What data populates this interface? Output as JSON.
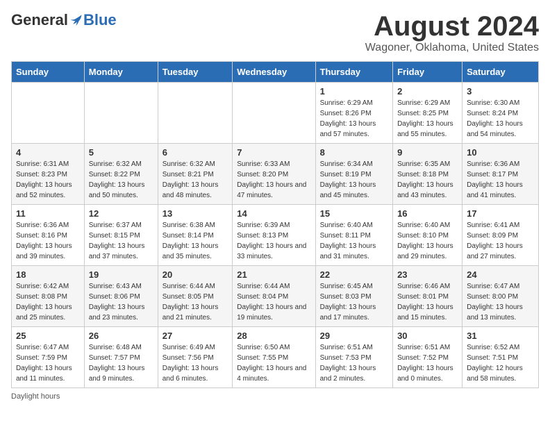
{
  "header": {
    "logo_general": "General",
    "logo_blue": "Blue",
    "month_year": "August 2024",
    "location": "Wagoner, Oklahoma, United States"
  },
  "days_of_week": [
    "Sunday",
    "Monday",
    "Tuesday",
    "Wednesday",
    "Thursday",
    "Friday",
    "Saturday"
  ],
  "footer": {
    "note": "Daylight hours"
  },
  "weeks": [
    [
      {
        "day": "",
        "sunrise": "",
        "sunset": "",
        "daylight": ""
      },
      {
        "day": "",
        "sunrise": "",
        "sunset": "",
        "daylight": ""
      },
      {
        "day": "",
        "sunrise": "",
        "sunset": "",
        "daylight": ""
      },
      {
        "day": "",
        "sunrise": "",
        "sunset": "",
        "daylight": ""
      },
      {
        "day": "1",
        "sunrise": "Sunrise: 6:29 AM",
        "sunset": "Sunset: 8:26 PM",
        "daylight": "Daylight: 13 hours and 57 minutes."
      },
      {
        "day": "2",
        "sunrise": "Sunrise: 6:29 AM",
        "sunset": "Sunset: 8:25 PM",
        "daylight": "Daylight: 13 hours and 55 minutes."
      },
      {
        "day": "3",
        "sunrise": "Sunrise: 6:30 AM",
        "sunset": "Sunset: 8:24 PM",
        "daylight": "Daylight: 13 hours and 54 minutes."
      }
    ],
    [
      {
        "day": "4",
        "sunrise": "Sunrise: 6:31 AM",
        "sunset": "Sunset: 8:23 PM",
        "daylight": "Daylight: 13 hours and 52 minutes."
      },
      {
        "day": "5",
        "sunrise": "Sunrise: 6:32 AM",
        "sunset": "Sunset: 8:22 PM",
        "daylight": "Daylight: 13 hours and 50 minutes."
      },
      {
        "day": "6",
        "sunrise": "Sunrise: 6:32 AM",
        "sunset": "Sunset: 8:21 PM",
        "daylight": "Daylight: 13 hours and 48 minutes."
      },
      {
        "day": "7",
        "sunrise": "Sunrise: 6:33 AM",
        "sunset": "Sunset: 8:20 PM",
        "daylight": "Daylight: 13 hours and 47 minutes."
      },
      {
        "day": "8",
        "sunrise": "Sunrise: 6:34 AM",
        "sunset": "Sunset: 8:19 PM",
        "daylight": "Daylight: 13 hours and 45 minutes."
      },
      {
        "day": "9",
        "sunrise": "Sunrise: 6:35 AM",
        "sunset": "Sunset: 8:18 PM",
        "daylight": "Daylight: 13 hours and 43 minutes."
      },
      {
        "day": "10",
        "sunrise": "Sunrise: 6:36 AM",
        "sunset": "Sunset: 8:17 PM",
        "daylight": "Daylight: 13 hours and 41 minutes."
      }
    ],
    [
      {
        "day": "11",
        "sunrise": "Sunrise: 6:36 AM",
        "sunset": "Sunset: 8:16 PM",
        "daylight": "Daylight: 13 hours and 39 minutes."
      },
      {
        "day": "12",
        "sunrise": "Sunrise: 6:37 AM",
        "sunset": "Sunset: 8:15 PM",
        "daylight": "Daylight: 13 hours and 37 minutes."
      },
      {
        "day": "13",
        "sunrise": "Sunrise: 6:38 AM",
        "sunset": "Sunset: 8:14 PM",
        "daylight": "Daylight: 13 hours and 35 minutes."
      },
      {
        "day": "14",
        "sunrise": "Sunrise: 6:39 AM",
        "sunset": "Sunset: 8:13 PM",
        "daylight": "Daylight: 13 hours and 33 minutes."
      },
      {
        "day": "15",
        "sunrise": "Sunrise: 6:40 AM",
        "sunset": "Sunset: 8:11 PM",
        "daylight": "Daylight: 13 hours and 31 minutes."
      },
      {
        "day": "16",
        "sunrise": "Sunrise: 6:40 AM",
        "sunset": "Sunset: 8:10 PM",
        "daylight": "Daylight: 13 hours and 29 minutes."
      },
      {
        "day": "17",
        "sunrise": "Sunrise: 6:41 AM",
        "sunset": "Sunset: 8:09 PM",
        "daylight": "Daylight: 13 hours and 27 minutes."
      }
    ],
    [
      {
        "day": "18",
        "sunrise": "Sunrise: 6:42 AM",
        "sunset": "Sunset: 8:08 PM",
        "daylight": "Daylight: 13 hours and 25 minutes."
      },
      {
        "day": "19",
        "sunrise": "Sunrise: 6:43 AM",
        "sunset": "Sunset: 8:06 PM",
        "daylight": "Daylight: 13 hours and 23 minutes."
      },
      {
        "day": "20",
        "sunrise": "Sunrise: 6:44 AM",
        "sunset": "Sunset: 8:05 PM",
        "daylight": "Daylight: 13 hours and 21 minutes."
      },
      {
        "day": "21",
        "sunrise": "Sunrise: 6:44 AM",
        "sunset": "Sunset: 8:04 PM",
        "daylight": "Daylight: 13 hours and 19 minutes."
      },
      {
        "day": "22",
        "sunrise": "Sunrise: 6:45 AM",
        "sunset": "Sunset: 8:03 PM",
        "daylight": "Daylight: 13 hours and 17 minutes."
      },
      {
        "day": "23",
        "sunrise": "Sunrise: 6:46 AM",
        "sunset": "Sunset: 8:01 PM",
        "daylight": "Daylight: 13 hours and 15 minutes."
      },
      {
        "day": "24",
        "sunrise": "Sunrise: 6:47 AM",
        "sunset": "Sunset: 8:00 PM",
        "daylight": "Daylight: 13 hours and 13 minutes."
      }
    ],
    [
      {
        "day": "25",
        "sunrise": "Sunrise: 6:47 AM",
        "sunset": "Sunset: 7:59 PM",
        "daylight": "Daylight: 13 hours and 11 minutes."
      },
      {
        "day": "26",
        "sunrise": "Sunrise: 6:48 AM",
        "sunset": "Sunset: 7:57 PM",
        "daylight": "Daylight: 13 hours and 9 minutes."
      },
      {
        "day": "27",
        "sunrise": "Sunrise: 6:49 AM",
        "sunset": "Sunset: 7:56 PM",
        "daylight": "Daylight: 13 hours and 6 minutes."
      },
      {
        "day": "28",
        "sunrise": "Sunrise: 6:50 AM",
        "sunset": "Sunset: 7:55 PM",
        "daylight": "Daylight: 13 hours and 4 minutes."
      },
      {
        "day": "29",
        "sunrise": "Sunrise: 6:51 AM",
        "sunset": "Sunset: 7:53 PM",
        "daylight": "Daylight: 13 hours and 2 minutes."
      },
      {
        "day": "30",
        "sunrise": "Sunrise: 6:51 AM",
        "sunset": "Sunset: 7:52 PM",
        "daylight": "Daylight: 13 hours and 0 minutes."
      },
      {
        "day": "31",
        "sunrise": "Sunrise: 6:52 AM",
        "sunset": "Sunset: 7:51 PM",
        "daylight": "Daylight: 12 hours and 58 minutes."
      }
    ]
  ]
}
